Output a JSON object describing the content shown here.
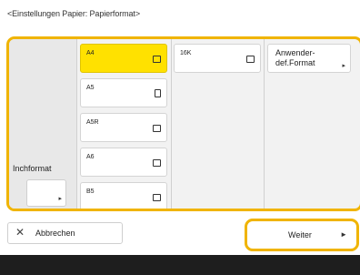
{
  "title": "<Einstellungen Papier: Papierformat>",
  "inch_format": {
    "label": "Inchformat",
    "button_arrow": "▸"
  },
  "formats": [
    {
      "label": "A4",
      "orientation": "landscape",
      "selected": true
    },
    {
      "label": "A5",
      "orientation": "portrait",
      "selected": false
    },
    {
      "label": "A5R",
      "orientation": "landscape",
      "selected": false
    },
    {
      "label": "A6",
      "orientation": "landscape",
      "selected": false
    },
    {
      "label": "B5",
      "orientation": "landscape",
      "selected": false
    },
    {
      "label": "16K",
      "orientation": "landscape",
      "selected": false
    }
  ],
  "user_defined": {
    "line1": "Anwender-",
    "line2": "def.Format",
    "arrow": "▸"
  },
  "cancel": {
    "icon": "close-icon",
    "glyph": "✕",
    "label": "Abbrechen"
  },
  "next": {
    "label": "Weiter",
    "arrow": "►"
  },
  "colors": {
    "accent": "#f0b400",
    "selected": "#ffe100",
    "footer": "#1e1e1e"
  }
}
